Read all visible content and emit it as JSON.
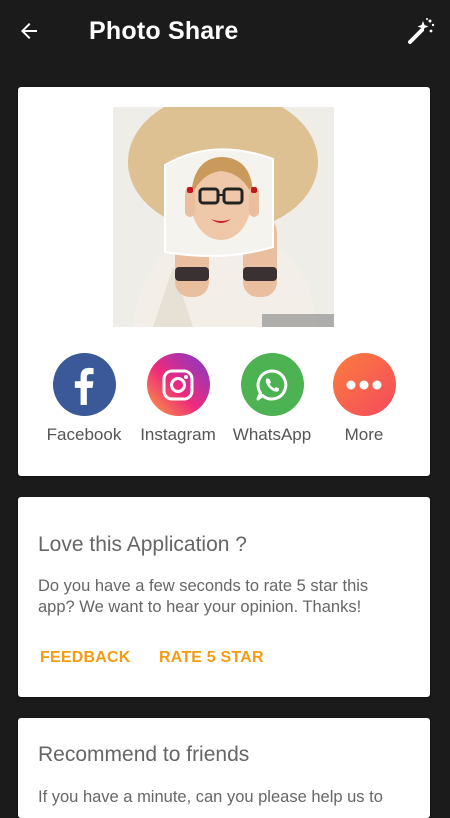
{
  "appbar": {
    "title": "Photo Share"
  },
  "share_options": [
    {
      "label": "Facebook",
      "icon": "facebook-icon"
    },
    {
      "label": "Instagram",
      "icon": "instagram-icon"
    },
    {
      "label": "WhatsApp",
      "icon": "whatsapp-icon"
    },
    {
      "label": "More",
      "icon": "more-icon"
    }
  ],
  "rate_card": {
    "title": "Love this Application ?",
    "message": "Do you have a few seconds to rate 5 star this app? We want to hear your opinion. Thanks!",
    "feedback_label": "FEEDBACK",
    "rate_label": "RATE 5 STAR"
  },
  "recommend_card": {
    "title": "Recommend to friends",
    "message": "If you have a minute, can you please help us to"
  },
  "colors": {
    "background": "#1b1b1b",
    "accent": "#f39c12"
  }
}
